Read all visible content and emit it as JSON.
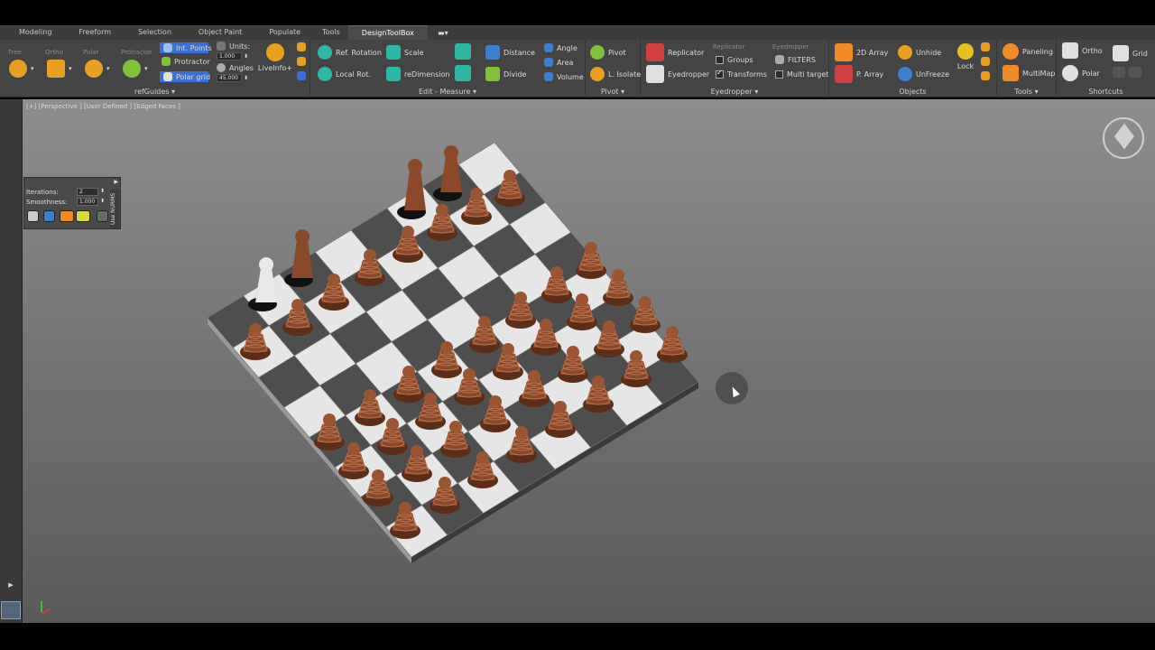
{
  "tabs": [
    "Modeling",
    "Freeform",
    "Selection",
    "Object Paint",
    "Populate",
    "Tools",
    "DesignToolBox"
  ],
  "active_tab": "DesignToolBox",
  "ribbon": {
    "refguides": {
      "faint": [
        "Free",
        "Ortho",
        "Polar",
        "Protractor"
      ],
      "int_points": "Int. Points",
      "protractor": "Protractor",
      "polar_grid": "Polar grid",
      "units_label": "Units:",
      "units_value": "1.000",
      "angles_label": "Angles",
      "angles_value": "45.000",
      "liveinfo": "LiveInfo+",
      "title": "refGuides"
    },
    "edit_measure": {
      "ref_rotation": "Ref. Rotation",
      "local_rot": "Local Rot.",
      "scale": "Scale",
      "redimension": "reDimension",
      "distance": "Distance",
      "divide": "Divide",
      "angle": "Angle",
      "area": "Area",
      "volume": "Volume",
      "title": "Edit - Measure"
    },
    "pivot": {
      "pivot": "Pivot",
      "l_isolate": "L. Isolate",
      "title": "Pivot"
    },
    "eyedropper": {
      "replicator": "Replicator",
      "eyedropper": "Eyedropper",
      "faint_replicator": "Replicator",
      "groups": "Groups",
      "transforms": "Transforms",
      "faint_eyedropper": "Eyedropper",
      "filters": "FILTERS",
      "multi_target": "Multi target",
      "groups_checked": false,
      "transforms_checked": true,
      "multi_target_checked": false,
      "title": "Eyedropper"
    },
    "objects": {
      "array_2d": "2D Array",
      "p_array": "P. Array",
      "unhide": "Unhide",
      "unfreeze": "UnFreeze",
      "lock": "Lock",
      "title": "Objects"
    },
    "tools": {
      "paneling": "Paneling",
      "multimap": "MultiMap",
      "title": "Tools"
    },
    "shortcuts": {
      "ortho": "Ortho",
      "polar": "Polar",
      "grid": "Grid",
      "title": "Shortcuts"
    }
  },
  "viewport": {
    "label": "[+] [Perspective ] [User Defined ] [Edged Faces ]",
    "nurms": {
      "iterations_label": "Iterations:",
      "iterations_value": "2",
      "smoothness_label": "Smoothness:",
      "smoothness_value": "1.000",
      "title": "Use NURMS"
    }
  },
  "colors": {
    "ribbon_bg": "#444444",
    "piece": "#8a4a2a",
    "light_square": "#e6e6e6",
    "dark_square": "#4e4e4e",
    "accent_blue": "#3a6fd8",
    "orange": "#f08a24"
  }
}
